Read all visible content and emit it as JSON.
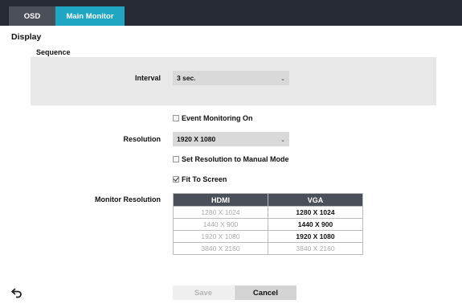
{
  "tabs": [
    {
      "label": "OSD"
    },
    {
      "label": "Main Monitor"
    }
  ],
  "page_title": "Display",
  "sequence": {
    "section_label": "Sequence",
    "interval_label": "Interval",
    "interval_value": "3 sec."
  },
  "event_monitoring": {
    "label": "Event Monitoring On",
    "checked": false
  },
  "resolution": {
    "label": "Resolution",
    "value": "1920 X 1080"
  },
  "manual_mode": {
    "label": "Set Resolution to Manual Mode",
    "checked": false
  },
  "fit_to_screen": {
    "label": "Fit To Screen",
    "checked": true
  },
  "monitor_resolution": {
    "label": "Monitor Resolution",
    "headers": [
      "HDMI",
      "VGA"
    ],
    "rows": [
      [
        {
          "text": "1280 X 1024",
          "enabled": false
        },
        {
          "text": "1280 X 1024",
          "enabled": true
        }
      ],
      [
        {
          "text": "1440 X 900",
          "enabled": false
        },
        {
          "text": "1440 X 900",
          "enabled": true
        }
      ],
      [
        {
          "text": "1920 X 1080",
          "enabled": false
        },
        {
          "text": "1920 X 1080",
          "enabled": true
        }
      ],
      [
        {
          "text": "3840 X 2160",
          "enabled": false
        },
        {
          "text": "3840 X 2160",
          "enabled": false
        }
      ]
    ]
  },
  "buttons": {
    "save": "Save",
    "cancel": "Cancel"
  },
  "icons": {
    "back": "back-arrow-icon",
    "dropdown": "chevron-down-icon"
  },
  "colors": {
    "active_tab": "#1ea6c2",
    "tab_bar": "#252a35",
    "table_header": "#4a4f5a"
  }
}
